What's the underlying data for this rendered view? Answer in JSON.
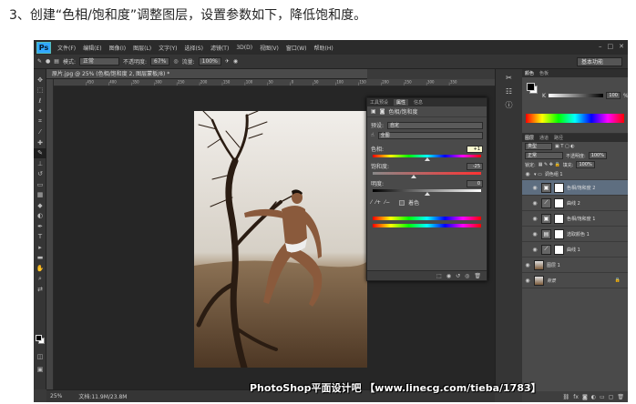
{
  "caption": "3、创建“色相/饱和度”调整图层，设置参数如下，降低饱和度。",
  "menubar": {
    "logo": "Ps",
    "items": [
      "文件(F)",
      "编辑(E)",
      "图像(I)",
      "图层(L)",
      "文字(Y)",
      "选择(S)",
      "滤镜(T)",
      "3D(D)",
      "视图(V)",
      "窗口(W)",
      "帮助(H)"
    ]
  },
  "options": {
    "mode_label": "模式:",
    "mode_value": "正常",
    "opacity_label": "不透明度:",
    "opacity_value": "67%",
    "flow_label": "流量:",
    "flow_value": "100%",
    "workspace": "基本功能"
  },
  "document": {
    "tab": "原片.jpg @ 25% (色相/饱和度 2, 图层蒙板/8) *",
    "ruler_ticks": [
      "450",
      "400",
      "350",
      "300",
      "250",
      "200",
      "150",
      "100",
      "50",
      "0",
      "50",
      "100",
      "150",
      "200",
      "250",
      "300",
      "350"
    ],
    "zoom": "25%",
    "doc_size": "文档:11.9M/23.8M"
  },
  "properties": {
    "tabs": [
      "工具预设",
      "属性",
      "信息"
    ],
    "active_tab": "属性",
    "title": "色相/饱和度",
    "preset_label": "预设:",
    "preset_value": "自定",
    "channel_value": "全图",
    "hue_label": "色相:",
    "hue_value": "+1",
    "saturation_label": "饱和度:",
    "saturation_value": "-25",
    "lightness_label": "明度:",
    "lightness_value": "0",
    "colorize_label": "着色",
    "hue_pct": 0.5,
    "saturation_pct": 0.375,
    "lightness_pct": 0.5
  },
  "color_panel": {
    "tabs": [
      "颜色",
      "色板"
    ],
    "k_label": "K",
    "k_value": "100",
    "k_unit": "%"
  },
  "layers_panel": {
    "tabs": [
      "图层",
      "通道",
      "路径"
    ],
    "filter_label": "类型",
    "blend_value": "正常",
    "opacity_label": "不透明度:",
    "opacity_value": "100%",
    "lock_label": "锁定:",
    "fill_label": "填充:",
    "fill_value": "100%",
    "layers": [
      {
        "name": "调色组 1",
        "kind": "group"
      },
      {
        "name": "色相/饱和度 2",
        "kind": "adj",
        "selected": true
      },
      {
        "name": "曲线 2",
        "kind": "adj"
      },
      {
        "name": "色相/饱和度 1",
        "kind": "adj"
      },
      {
        "name": "选取颜色 1",
        "kind": "adj"
      },
      {
        "name": "曲线 1",
        "kind": "adj"
      },
      {
        "name": "图层 1",
        "kind": "pixel"
      },
      {
        "name": "背景",
        "kind": "bg"
      }
    ]
  },
  "watermark": "PhotoShop平面设计吧 【www.linecg.com/tieba/1783】"
}
